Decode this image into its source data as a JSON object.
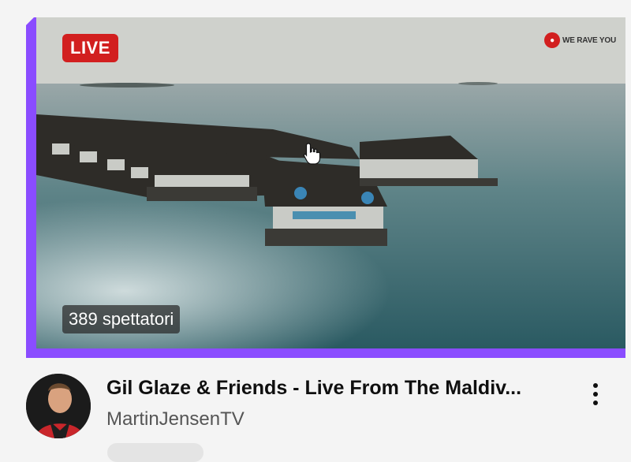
{
  "video": {
    "live_label": "LIVE",
    "viewers_label": "389 spettatori",
    "watermark_text": "WE RAVE YOU",
    "title": "Gil Glaze & Friends - Live From The Maldiv...",
    "channel": "MartinJensenTV"
  },
  "colors": {
    "live_badge": "#d21f1f",
    "frame_accent": "#8a4cff"
  },
  "icons": {
    "menu": "more-vertical-icon",
    "cursor": "hand-pointer-icon"
  }
}
